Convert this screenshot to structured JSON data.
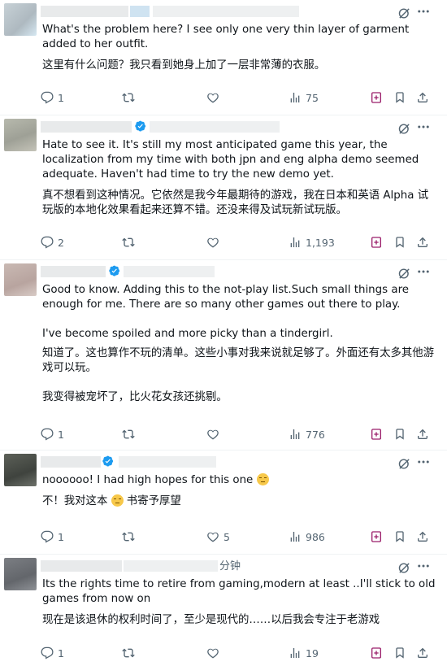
{
  "tweets": [
    {
      "time": "",
      "en": "What's the problem here? I see only one very thin layer of garment added to her outfit.",
      "zh": "这里有什么问题？我只看到她身上加了一层非常薄的衣服。",
      "replies": "1",
      "reposts": "",
      "likes": "",
      "views": "75"
    },
    {
      "time": "",
      "en": "Hate to see it. It's still my most anticipated game this year, the localization from my time with both jpn and eng alpha demo seemed adequate. Haven't had time to try the new demo yet.",
      "zh": "真不想看到这种情况。它依然是我今年最期待的游戏，我在日本和英语 Alpha 试玩版的本地化效果看起来还算不错。还没来得及试玩新试玩版。",
      "replies": "2",
      "reposts": "",
      "likes": "",
      "views": "1,193"
    },
    {
      "time": "",
      "en": "Good to know. Adding this to the not-play list.Such small things are enough for me. There are so many other games out there to play.",
      "en2": "I've become spoiled and more picky than a tindergirl.",
      "zh": "知道了。这也算作不玩的清单。这些小事对我来说就足够了。外面还有太多其他游戏可以玩。",
      "zh2": "我变得被宠坏了，比火花女孩还挑剔。",
      "replies": "1",
      "reposts": "",
      "likes": "",
      "views": "776"
    },
    {
      "time": "",
      "en": "noooooo! I had high hopes for this one",
      "zh_a": "不！我对这本",
      "zh_b": "书寄予厚望",
      "replies": "1",
      "reposts": "",
      "likes": "5",
      "views": "986"
    },
    {
      "time": "分钟",
      "en": "Its the rights time to retire from gaming,modern at least ..I'll stick to old games from now on",
      "zh": "现在是该退休的权利时间了，至少是现代的……以后我会专注于老游戏",
      "replies": "1",
      "reposts": "",
      "likes": "",
      "views": "19"
    }
  ],
  "colors": {
    "icon": "#536471",
    "verified": "#1d9bf0",
    "text": "#0f1419",
    "divider": "#eff3f4"
  },
  "icons": [
    "reply-icon",
    "repost-icon",
    "like-icon",
    "views-icon",
    "grok-icon",
    "bookmark-icon",
    "share-icon",
    "more-icon",
    "verified-badge-icon",
    "pensive-emoji-icon"
  ]
}
